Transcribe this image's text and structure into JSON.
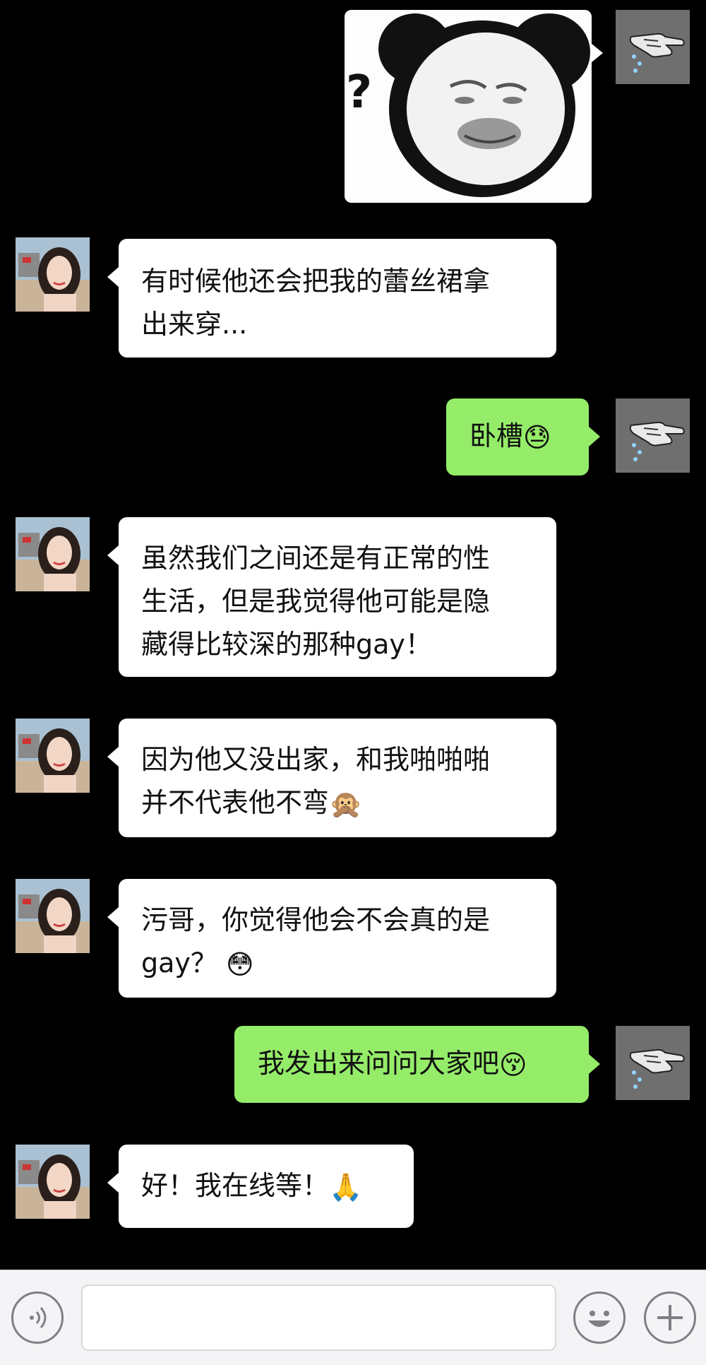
{
  "conversation": {
    "messages": [
      {
        "id": "m1",
        "sender": "me",
        "type": "sticker",
        "sticker_text": "?"
      },
      {
        "id": "m2",
        "sender": "her",
        "type": "text",
        "lines": [
          "有时候他还会把我的蕾丝裙拿",
          "出来穿..."
        ]
      },
      {
        "id": "m3",
        "sender": "me",
        "type": "text",
        "lines": [
          "卧槽"
        ],
        "emoji": "😓"
      },
      {
        "id": "m4",
        "sender": "her",
        "type": "text",
        "lines": [
          "虽然我们之间还是有正常的性",
          "生活，但是我觉得他可能是隐",
          "藏得比较深的那种gay！"
        ]
      },
      {
        "id": "m5",
        "sender": "her",
        "type": "text",
        "lines": [
          "因为他又没出家，和我啪啪啪",
          "并不代表他不弯"
        ],
        "emoji": "🙊"
      },
      {
        "id": "m6",
        "sender": "her",
        "type": "text",
        "lines": [
          "污哥，你觉得他会不会真的是",
          "gay？"
        ],
        "emoji": "😳"
      },
      {
        "id": "m7",
        "sender": "me",
        "type": "text",
        "lines": [
          "我发出来问问大家吧"
        ],
        "emoji": "😚"
      },
      {
        "id": "m8",
        "sender": "her",
        "type": "text",
        "lines": [
          "好！我在线等！"
        ],
        "emoji": "🙏"
      }
    ]
  },
  "input_bar": {
    "voice_icon": "voice-wave-icon",
    "emoji_icon": "smiley-icon",
    "more_icon": "plus-icon",
    "text_value": ""
  },
  "colors": {
    "background": "#000000",
    "bubble_green": "#95ec69",
    "bubble_white": "#ffffff",
    "input_bar": "#f4f4f6"
  }
}
